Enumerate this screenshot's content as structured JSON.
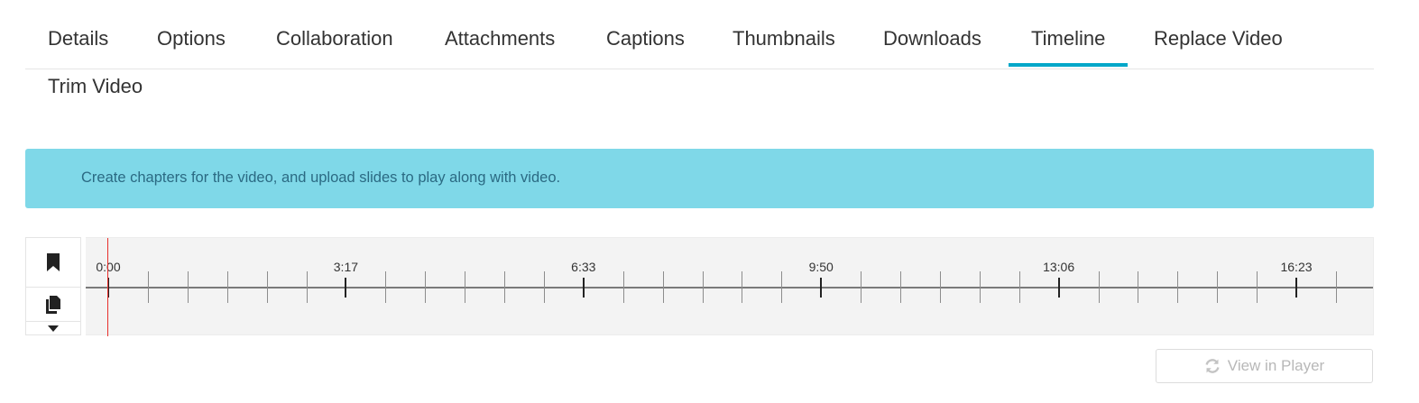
{
  "tabs": [
    {
      "label": "Details",
      "active": false
    },
    {
      "label": "Options",
      "active": false
    },
    {
      "label": "Collaboration",
      "active": false
    },
    {
      "label": "Attachments",
      "active": false
    },
    {
      "label": "Captions",
      "active": false
    },
    {
      "label": "Thumbnails",
      "active": false
    },
    {
      "label": "Downloads",
      "active": false
    },
    {
      "label": "Timeline",
      "active": true
    },
    {
      "label": "Replace Video",
      "active": false
    },
    {
      "label": "Trim Video",
      "active": false
    }
  ],
  "banner": {
    "text": "Create chapters for the video, and upload slides to play along with video.",
    "color": "#7fd8e8"
  },
  "timeline": {
    "tools": [
      {
        "icon": "bookmark-icon",
        "name": "add-chapter-button"
      },
      {
        "icon": "slides-icon",
        "name": "add-slides-button"
      },
      {
        "icon": "caret-down-icon",
        "name": "more-tools-button"
      }
    ],
    "tick_labels": [
      "0:00",
      "3:17",
      "6:33",
      "9:50",
      "13:06",
      "16:23"
    ],
    "playhead_time": "0:00",
    "playhead_color": "#e8302c"
  },
  "actions": {
    "view_in_player_label": "View in Player",
    "view_in_player_icon": "refresh-icon",
    "view_in_player_enabled": false
  },
  "accent_color": "#00a7c9"
}
